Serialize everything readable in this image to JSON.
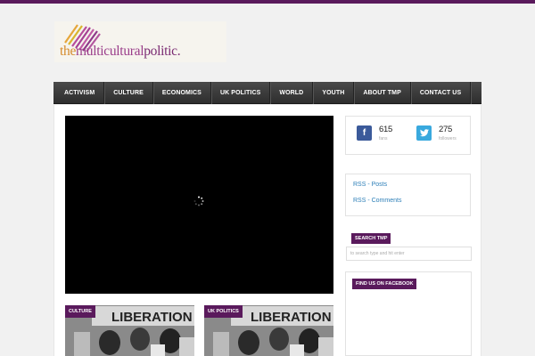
{
  "logo": {
    "the": "the",
    "multicultural": "multicultural",
    "politic": "politic."
  },
  "nav": {
    "items": [
      {
        "label": "ACTIVISM"
      },
      {
        "label": "CULTURE"
      },
      {
        "label": "ECONOMICS"
      },
      {
        "label": "UK POLITICS"
      },
      {
        "label": "WORLD"
      },
      {
        "label": "YOUTH"
      },
      {
        "label": "ABOUT TMP"
      },
      {
        "label": "CONTACT US"
      }
    ]
  },
  "social": {
    "facebook": {
      "count": "615",
      "label": "fans",
      "icon": "facebook-icon"
    },
    "twitter": {
      "count": "275",
      "label": "followers",
      "icon": "twitter-icon"
    }
  },
  "rss": {
    "posts": "RSS - Posts",
    "comments": "RSS - Comments"
  },
  "search": {
    "title": "SEARCH TMP",
    "placeholder": "to search type and hit enter"
  },
  "facebook_widget": {
    "title": "FIND US ON FACEBOOK"
  },
  "posts": [
    {
      "category": "CULTURE",
      "image_text": "LIBERATION"
    },
    {
      "category": "UK POLITICS",
      "image_text": "LIBERATION"
    }
  ],
  "colors": {
    "brand": "#5a1a5c",
    "nav": "#3a3a3a",
    "link": "#2d7fb8",
    "facebook": "#3b5a9a",
    "twitter": "#39a9de"
  }
}
